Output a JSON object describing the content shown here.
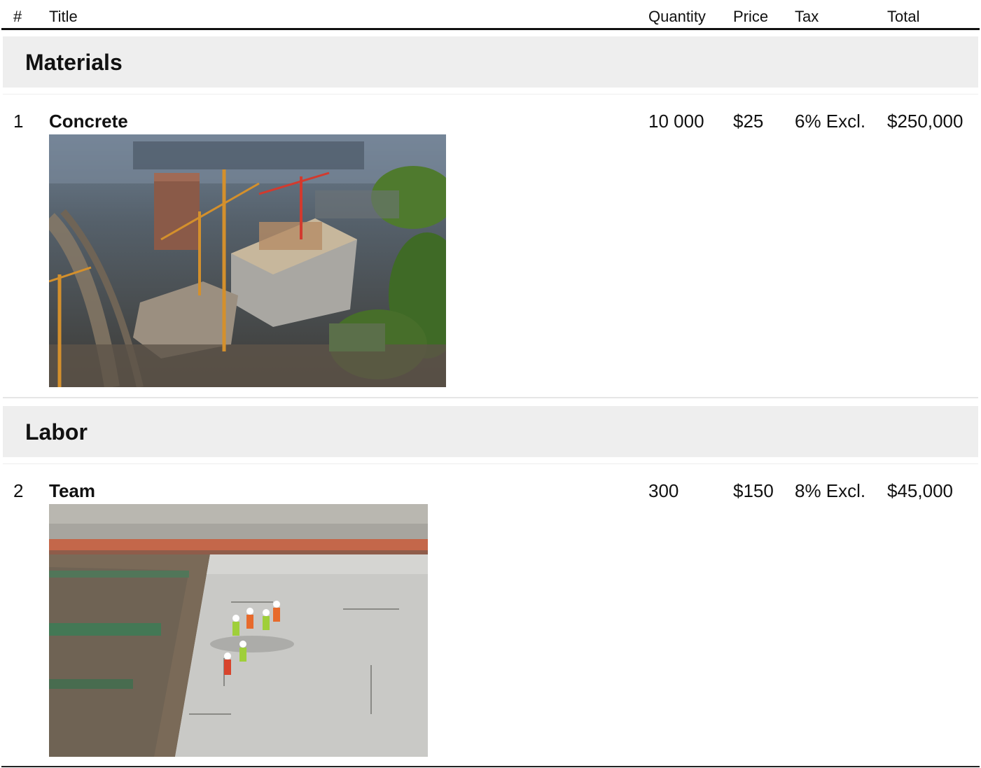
{
  "columns": {
    "num": "#",
    "title": "Title",
    "quantity": "Quantity",
    "price": "Price",
    "tax": "Tax",
    "total": "Total"
  },
  "groups": [
    {
      "name": "Materials",
      "items": [
        {
          "num": "1",
          "title": "Concrete",
          "quantity": "10 000",
          "price": "$25",
          "tax": "6% Excl.",
          "total": "$250,000",
          "image": "construction-site-aerial-photo"
        }
      ]
    },
    {
      "name": "Labor",
      "items": [
        {
          "num": "2",
          "title": "Team",
          "quantity": "300",
          "price": "$150",
          "tax": "8% Excl.",
          "total": "$45,000",
          "image": "workers-on-concrete-slab-photo"
        }
      ]
    }
  ]
}
